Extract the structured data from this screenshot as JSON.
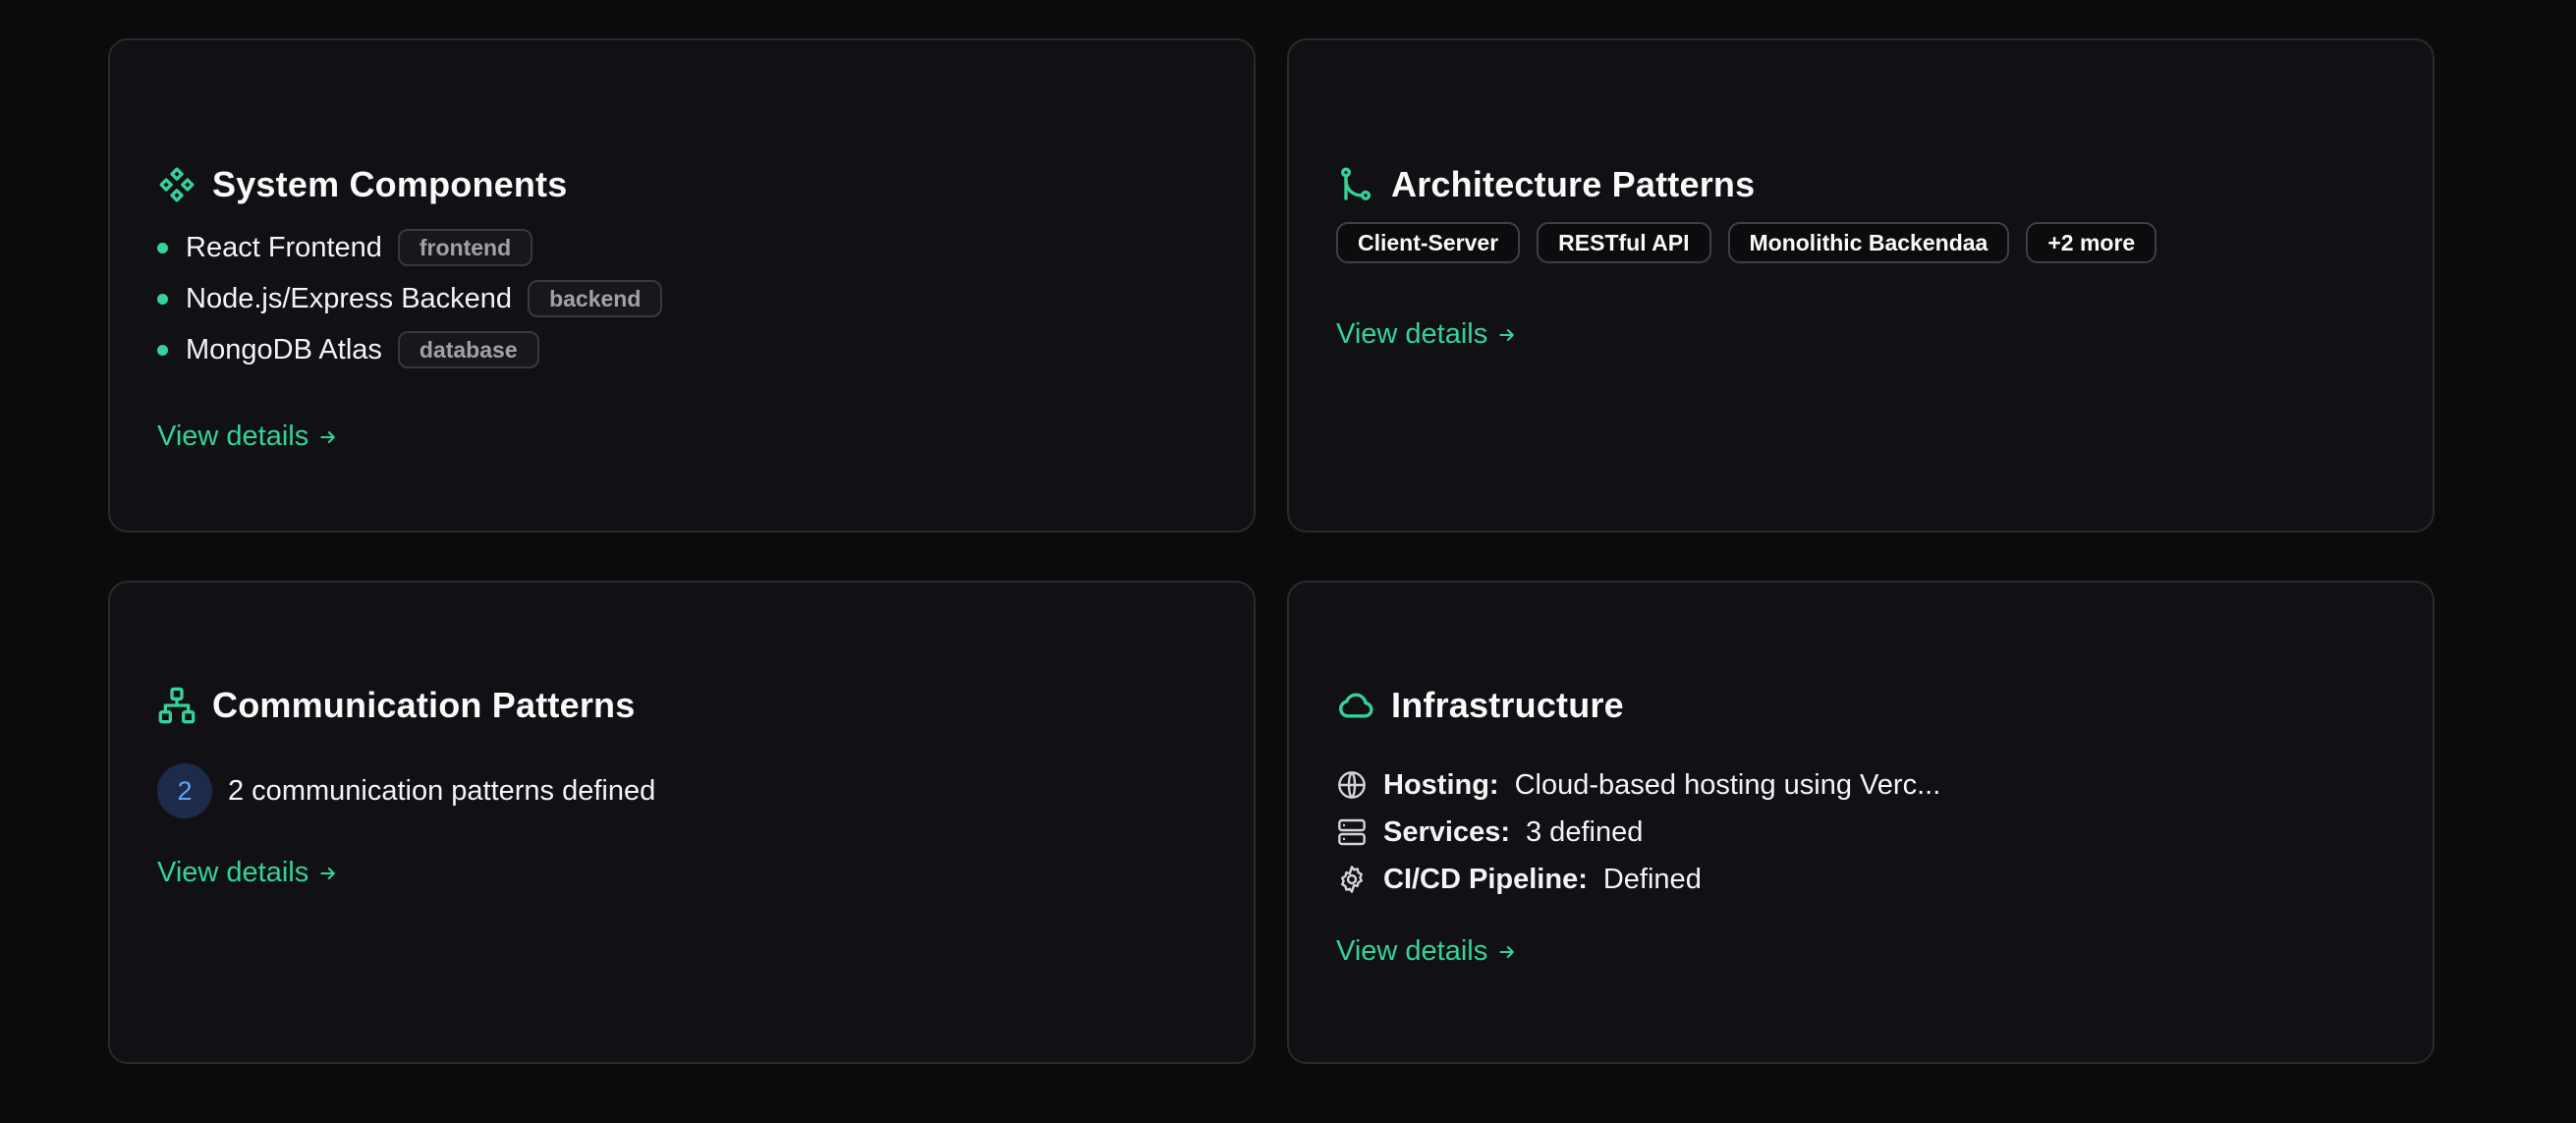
{
  "cards": {
    "components": {
      "title": "System Components",
      "icon": "components-icon",
      "items": [
        {
          "name": "React Frontend",
          "tag": "frontend"
        },
        {
          "name": "Node.js/Express Backend",
          "tag": "backend"
        },
        {
          "name": "MongoDB Atlas",
          "tag": "database"
        }
      ],
      "link": "View details"
    },
    "architecture": {
      "title": "Architecture Patterns",
      "icon": "git-branch-icon",
      "pills": [
        "Client-Server",
        "RESTful API",
        "Monolithic Backendaa",
        "+2 more"
      ],
      "link": "View details"
    },
    "communication": {
      "title": "Communication Patterns",
      "icon": "network-icon",
      "count": "2",
      "summary": "2 communication patterns defined",
      "link": "View details"
    },
    "infrastructure": {
      "title": "Infrastructure",
      "icon": "cloud-icon",
      "rows": [
        {
          "icon": "globe-icon",
          "label": "Hosting:",
          "value": "Cloud-based hosting using Verc..."
        },
        {
          "icon": "server-icon",
          "label": "Services:",
          "value": "3 defined"
        },
        {
          "icon": "gear-icon",
          "label": "CI/CD Pipeline:",
          "value": "Defined"
        }
      ],
      "link": "View details"
    }
  },
  "colors": {
    "accent": "#34d399",
    "background": "#0b0b0c",
    "card": "#111115",
    "badge_text": "#60a5fa"
  }
}
